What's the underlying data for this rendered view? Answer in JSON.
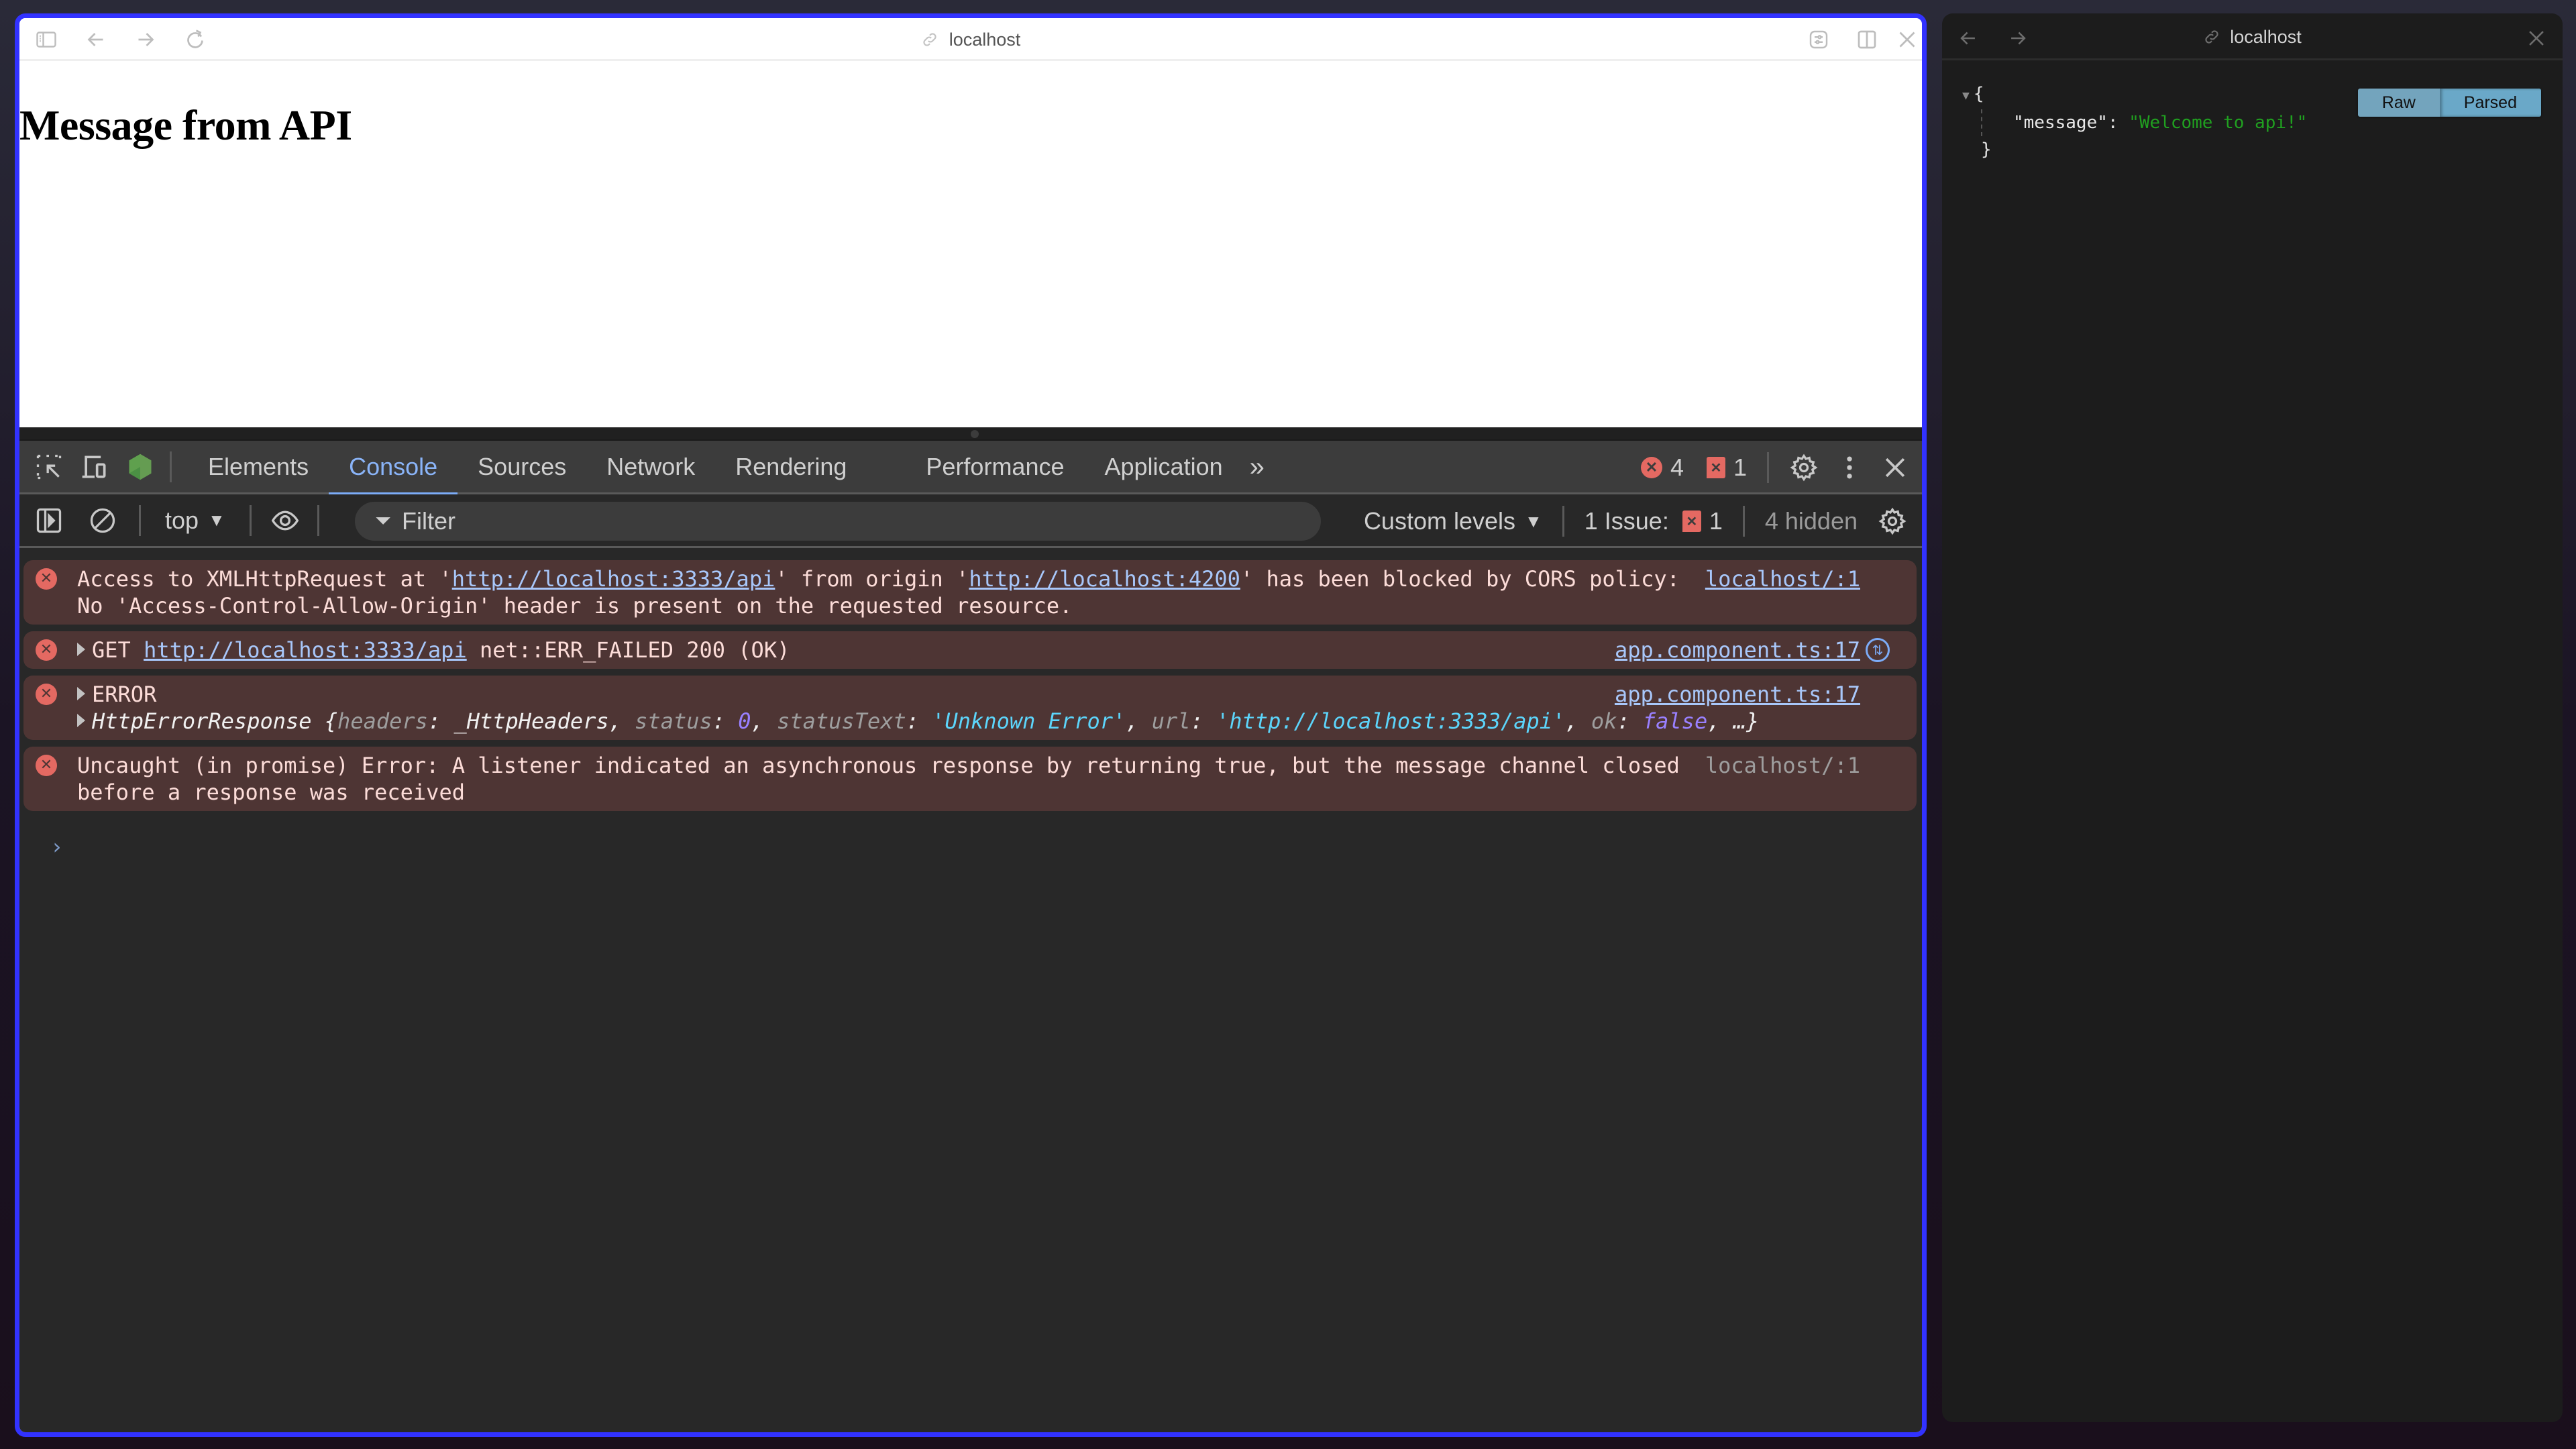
{
  "main_window": {
    "url": "localhost",
    "icons": {
      "left": [
        "sidebar-icon",
        "back-arrow-icon",
        "forward-arrow-icon",
        "reload-icon"
      ],
      "right": [
        "page-settings-icon",
        "split-view-icon",
        "close-icon"
      ]
    },
    "page": {
      "heading": "Message from API"
    }
  },
  "devtools": {
    "tabs": [
      {
        "label": "Elements",
        "active": false
      },
      {
        "label": "Console",
        "active": true
      },
      {
        "label": "Sources",
        "active": false
      },
      {
        "label": "Network",
        "active": false
      },
      {
        "label": "Rendering",
        "active": false
      },
      {
        "label": "Performance",
        "active": false
      },
      {
        "label": "Application",
        "active": false
      }
    ],
    "more_tabs_glyph": "»",
    "error_count": "4",
    "issue_count": "1",
    "console_toolbar": {
      "context": "top",
      "filter_placeholder": "Filter",
      "levels": "Custom levels",
      "issues_label": "1 Issue:",
      "issues_count": "1",
      "hidden": "4 hidden"
    },
    "messages": [
      {
        "level": "error",
        "parts": {
          "t1": "Access to XMLHttpRequest at '",
          "link1": "http://localhost:3333/api",
          "t2": "' from origin '",
          "link2": "http://localhost:4200",
          "t3": "' has been blocked by CORS policy: No 'Access-Control-Allow-Origin' header is present on the requested resource."
        },
        "source": "localhost/:1"
      },
      {
        "level": "error",
        "parts": {
          "method": "GET",
          "link": "http://localhost:3333/api",
          "status": "net::ERR_FAILED 200 (OK)"
        },
        "source": "app.component.ts:17"
      },
      {
        "level": "error",
        "parts": {
          "title": "ERROR",
          "class": "HttpErrorResponse",
          "open": "{",
          "k_headers": "headers",
          "v_headers": "_HttpHeaders",
          "k_status": "status",
          "v_status": "0",
          "k_statusText": "statusText",
          "v_statusText": "'Unknown Error'",
          "k_url": "url",
          "v_url": "'http://localhost:3333/api'",
          "k_ok": "ok",
          "v_ok": "false",
          "close": "…}"
        },
        "source": "app.component.ts:17"
      },
      {
        "level": "error",
        "text": "Uncaught (in promise) Error: A listener indicated an asynchronous response by returning true, but the message channel closed before a response was received",
        "source": "localhost/:1"
      }
    ],
    "prompt_glyph": "›"
  },
  "side_window": {
    "url": "localhost",
    "json": {
      "open": "{",
      "key": "\"message\"",
      "value": "\"Welcome to api!\"",
      "close": "}"
    },
    "view_toggle": {
      "raw": "Raw",
      "parsed": "Parsed",
      "active": "parsed"
    }
  }
}
